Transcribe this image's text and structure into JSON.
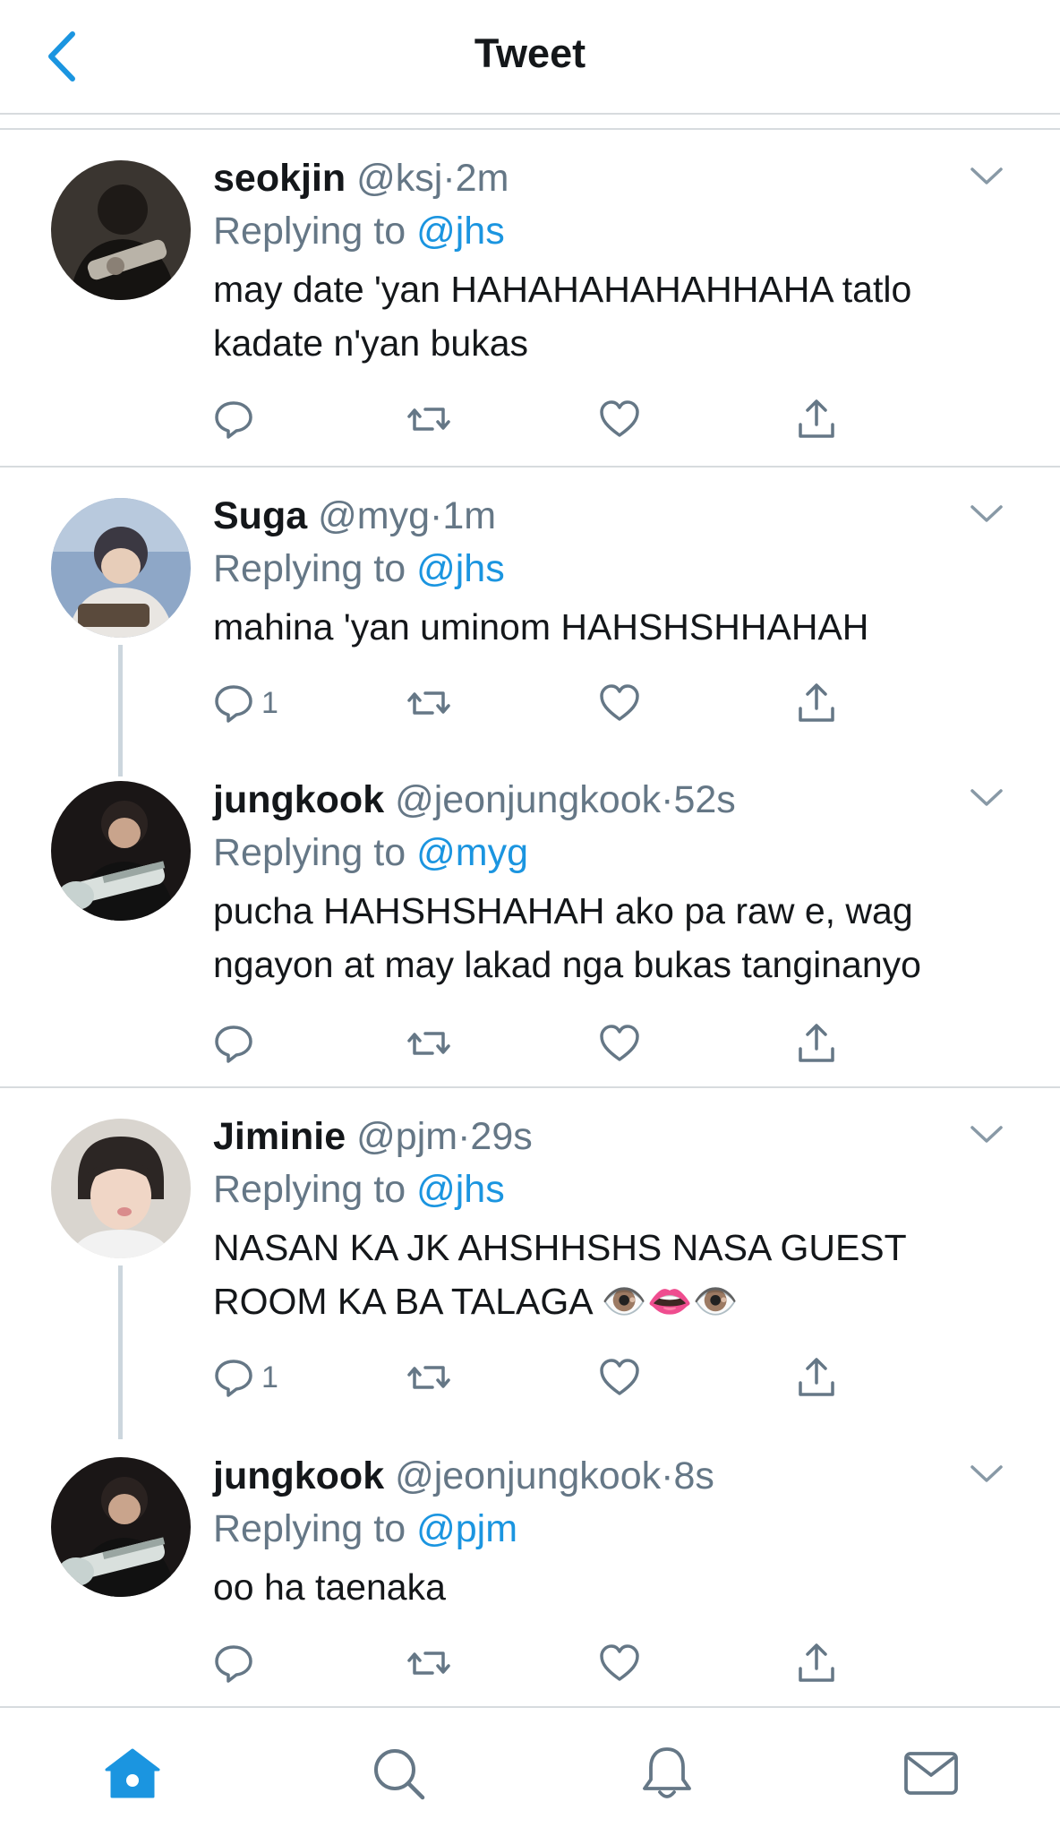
{
  "header": {
    "title": "Tweet",
    "back_icon": "chevron-left-icon"
  },
  "colors": {
    "accent": "#1b95e0",
    "text": "#14171a",
    "muted": "#657786",
    "divider": "#d7dbde"
  },
  "tweets": [
    {
      "name": "seokjin",
      "handle": "@ksj",
      "time": "2m",
      "replying_label": "Replying to",
      "replying_to": "@jhs",
      "text": "may date 'yan HAHAHAHAHAHHAHA tatlo kadate n'yan bukas",
      "reply_count": ""
    },
    {
      "name": "Suga",
      "handle": "@myg",
      "time": "1m",
      "replying_label": "Replying to",
      "replying_to": "@jhs",
      "text": "mahina 'yan uminom HAHSHSHHAHAH",
      "reply_count": "1"
    },
    {
      "name": "jungkook",
      "handle": "@jeonjungkook",
      "time": "52s",
      "replying_label": "Replying to",
      "replying_to": "@myg",
      "text": "pucha HAHSHSHAHAH ako pa raw e, wag ngayon at may lakad nga bukas tanginanyo",
      "reply_count": ""
    },
    {
      "name": "Jiminie",
      "handle": "@pjm",
      "time": "29s",
      "replying_label": "Replying to",
      "replying_to": "@jhs",
      "text": "NASAN KA JK AHSHHSHS NASA GUEST ROOM KA BA TALAGA 👁️👄👁️",
      "reply_count": "1"
    },
    {
      "name": "jungkook",
      "handle": "@jeonjungkook",
      "time": "8s",
      "replying_label": "Replying to",
      "replying_to": "@pjm",
      "text": "oo ha taenaka",
      "reply_count": ""
    }
  ],
  "separator": "·",
  "tabbar": {
    "items": [
      "home-icon",
      "search-icon",
      "notifications-icon",
      "messages-icon"
    ]
  }
}
